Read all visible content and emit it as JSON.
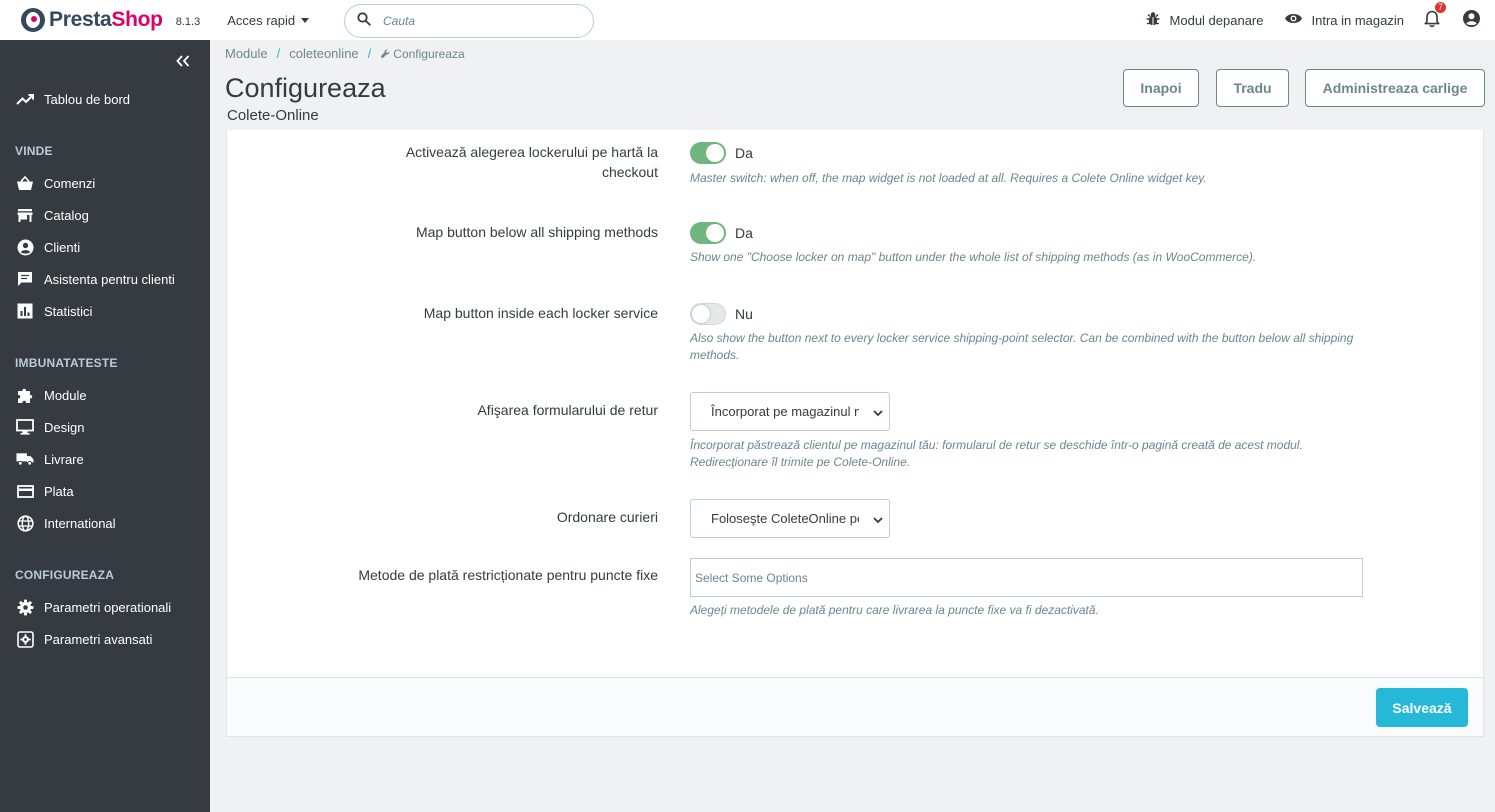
{
  "header": {
    "logo_presta": "Presta",
    "logo_shop": "Shop",
    "version": "8.1.3",
    "quick_access": "Acces rapid",
    "search_placeholder": "Cauta",
    "debug_mode": "Modul depanare",
    "view_shop": "Intra in magazin",
    "notifications_count": "7"
  },
  "sidebar": {
    "dashboard": "Tablou de bord",
    "section_sell": "VINDE",
    "orders": "Comenzi",
    "catalog": "Catalog",
    "customers": "Clienti",
    "customer_service": "Asistenta pentru clienti",
    "stats": "Statistici",
    "section_improve": "IMBUNATATESTE",
    "modules": "Module",
    "design": "Design",
    "shipping": "Livrare",
    "payment": "Plata",
    "international": "International",
    "section_configure": "CONFIGUREAZA",
    "operational_params": "Parametri operationali",
    "advanced_params": "Parametri avansati"
  },
  "breadcrumb": {
    "module": "Module",
    "sep1": "/",
    "coleteonline": "coleteonline",
    "sep2": "/",
    "current": "Configureaza"
  },
  "page": {
    "title": "Configureaza",
    "subtitle": "Colete-Online",
    "back": "Inapoi",
    "translate": "Tradu",
    "manage_hooks": "Administreaza carlige"
  },
  "form": {
    "map_locker": {
      "label": "Activează alegerea lockerului pe hartă la checkout",
      "state": "Da",
      "help": "Master switch: when off, the map widget is not loaded at all. Requires a Colete Online widget key."
    },
    "map_below": {
      "label": "Map button below all shipping methods",
      "state": "Da",
      "help": "Show one \"Choose locker on map\" button under the whole list of shipping methods (as in WooCommerce)."
    },
    "map_inside": {
      "label": "Map button inside each locker service",
      "state": "Nu",
      "help": "Also show the button next to every locker service shipping-point selector. Can be combined with the button below all shipping methods."
    },
    "return_form": {
      "label": "Afişarea formularului de retur",
      "value": "Încorporat pe magazinul meu",
      "help1": "Încorporat păstrează clientul pe magazinul tău: formularul de retur se deschide într-o pagină creată de acest modul.",
      "help2": "Redirecţionare îl trimite pe Colete-Online."
    },
    "courier_order": {
      "label": "Ordonare curieri",
      "value": "Foloseşte ColeteOnline pentru ordonare"
    },
    "restricted_payments": {
      "label": "Metode de plată restricționate pentru puncte fixe",
      "placeholder": "Select Some Options",
      "help": "Alegeți metodele de plată pentru care livrarea la puncte fixe va fi dezactivată."
    },
    "save": "Salvează"
  }
}
